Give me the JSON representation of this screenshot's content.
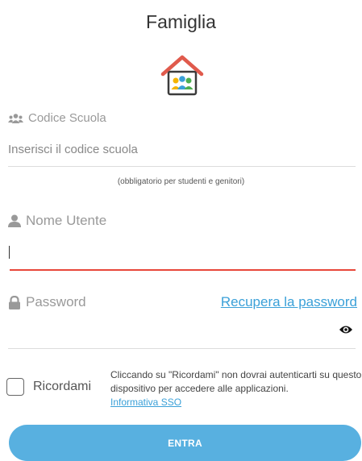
{
  "page": {
    "title": "Famiglia"
  },
  "school_code": {
    "label": "Codice Scuola",
    "placeholder": "Inserisci il codice scuola",
    "hint": "(obbligatorio per studenti e genitori)"
  },
  "username": {
    "label": "Nome Utente",
    "value": ""
  },
  "password": {
    "label": "Password",
    "recover_link": "Recupera la password"
  },
  "remember": {
    "label": "Ricordami",
    "info": "Cliccando su \"Ricordami\" non dovrai autenticarti su questo dispositivo per accedere alle applicazioni.",
    "sso_link": "Informativa SSO"
  },
  "submit": {
    "label": "ENTRA"
  },
  "colors": {
    "accent": "#58b0e0",
    "error_line": "#e8473a",
    "link": "#3aa0d8"
  },
  "icons": [
    "family-home-icon",
    "users-icon",
    "user-icon",
    "lock-icon",
    "eye-icon"
  ]
}
